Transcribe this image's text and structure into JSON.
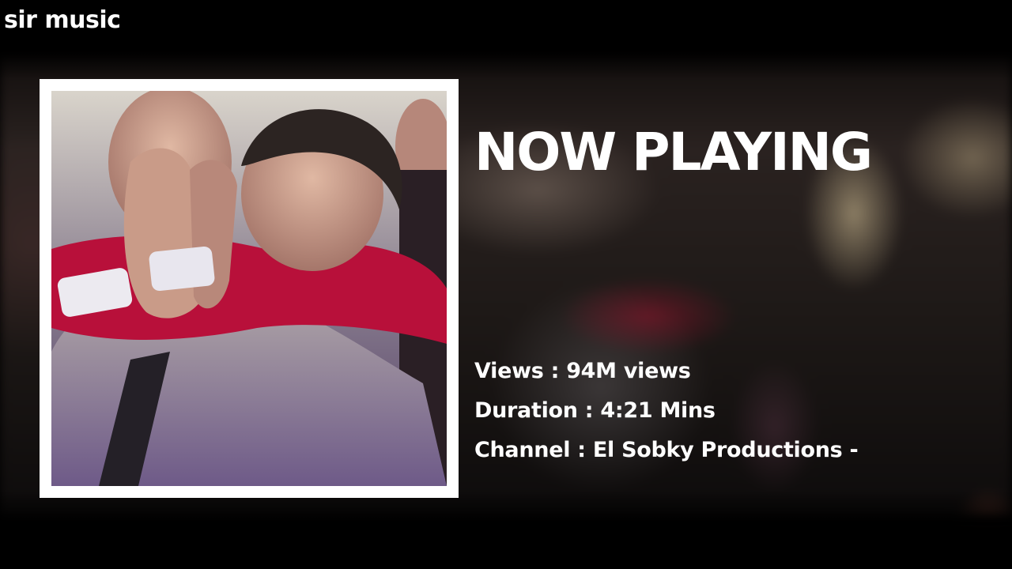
{
  "app": {
    "brand": "sir music"
  },
  "now_playing": {
    "heading": "NOW PLAYING",
    "artwork_alt": "album art"
  },
  "details": {
    "views_line": "Views : 94M views",
    "duration_line": "Duration : 4:21 Mins",
    "channel_line": "Channel : El Sobky Productions -"
  },
  "colors": {
    "text": "#ffffff",
    "frame": "#ffffff",
    "background": "#000000"
  }
}
